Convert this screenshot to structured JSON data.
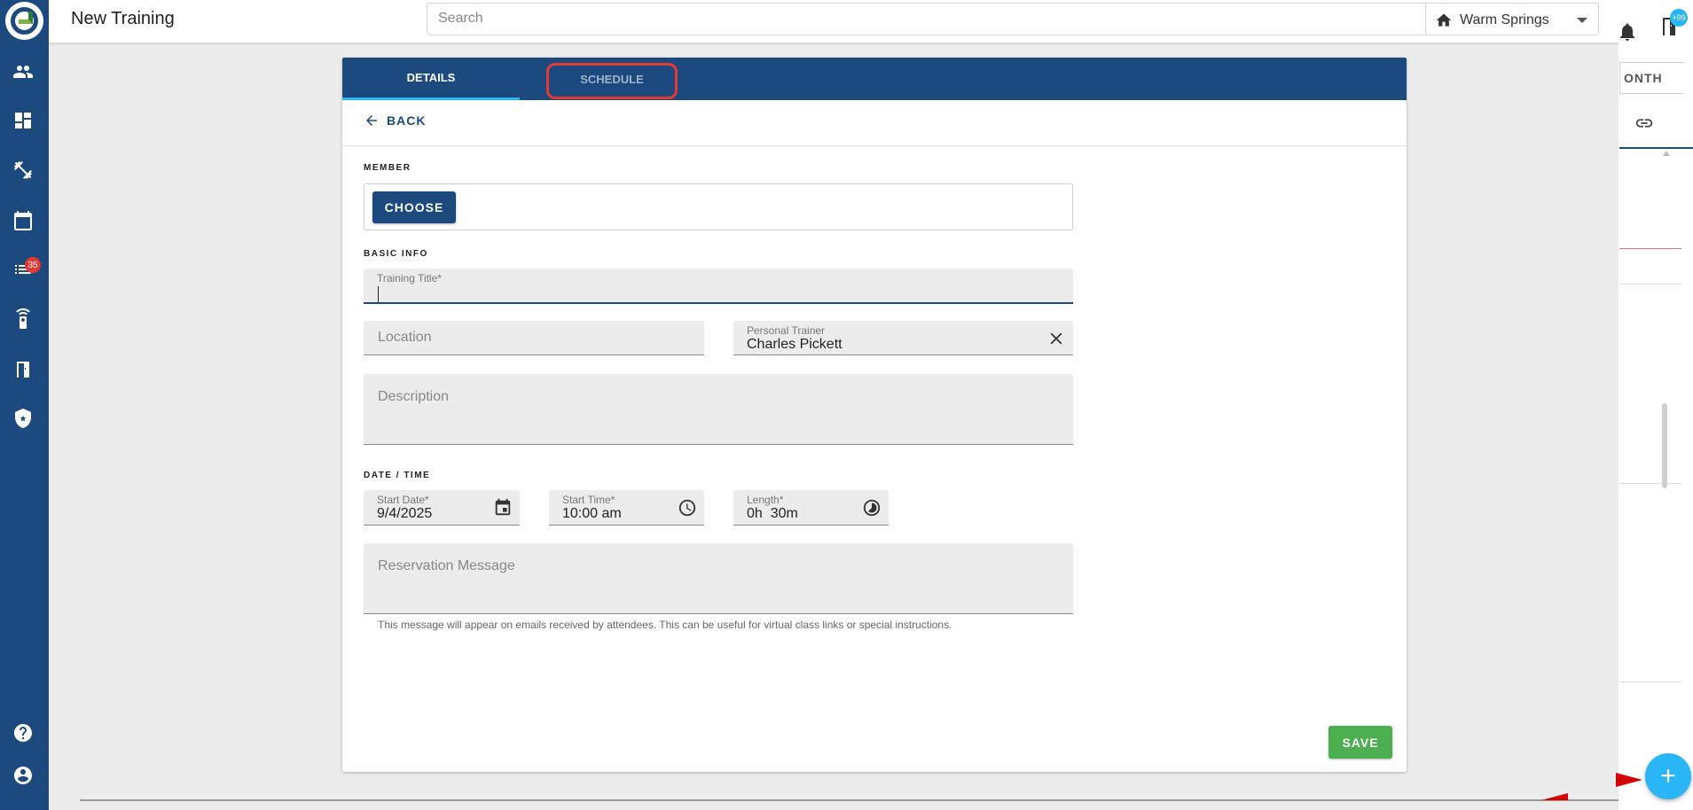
{
  "app": {
    "page_title": "New Training"
  },
  "search": {
    "placeholder": "Search"
  },
  "location": {
    "selected": "Warm Springs"
  },
  "sidebar": {
    "badge_count": "35",
    "items": [
      {
        "icon": "people-icon"
      },
      {
        "icon": "dashboard-icon"
      },
      {
        "icon": "fitness-icon"
      },
      {
        "icon": "calendar-icon"
      },
      {
        "icon": "list-icon"
      },
      {
        "icon": "remote-icon"
      },
      {
        "icon": "door-icon"
      },
      {
        "icon": "shield-icon"
      },
      {
        "icon": "help-icon"
      },
      {
        "icon": "account-icon"
      }
    ]
  },
  "right_panel": {
    "month_label": "ONTH",
    "notification_badge": "+99"
  },
  "tabs": [
    {
      "label": "DETAILS",
      "active": true
    },
    {
      "label": "SCHEDULE",
      "active": false
    }
  ],
  "back": {
    "label": "BACK"
  },
  "member": {
    "section_label": "MEMBER",
    "choose_label": "CHOOSE"
  },
  "basic_info": {
    "section_label": "BASIC INFO",
    "training_title_label": "Training Title*",
    "training_title_value": "",
    "location_placeholder": "Location",
    "trainer_label": "Personal Trainer",
    "trainer_value": "Charles Pickett",
    "description_placeholder": "Description"
  },
  "date_time": {
    "section_label": "DATE / TIME",
    "start_date_label": "Start Date*",
    "start_date_value": "9/4/2025",
    "start_time_label": "Start Time*",
    "start_time_value": "10:00 am",
    "length_label": "Length*",
    "length_value": "0h  30m"
  },
  "reservation": {
    "placeholder": "Reservation Message",
    "helper": "This message will appear on emails received by attendees. This can be useful for virtual class links or special instructions."
  },
  "actions": {
    "save_label": "SAVE"
  },
  "colors": {
    "primary": "#1c4a7e",
    "accent": "#29b6f6",
    "save": "#4caf50",
    "highlight": "#e53935"
  }
}
